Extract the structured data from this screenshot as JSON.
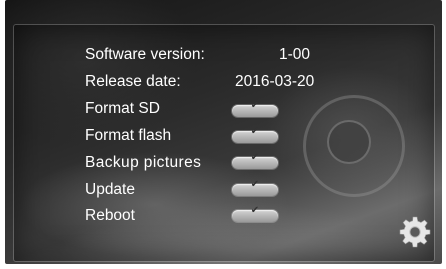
{
  "settings": {
    "software_version": {
      "label": "Software version:",
      "value": "1-00"
    },
    "release_date": {
      "label": "Release date:",
      "value": "2016-03-20"
    },
    "actions": [
      {
        "label": "Format SD",
        "control_glyph": "✔"
      },
      {
        "label": "Format flash",
        "control_glyph": "✔"
      },
      {
        "label": "Backup pictures",
        "control_glyph": "✔"
      },
      {
        "label": "Update",
        "control_glyph": "✔"
      },
      {
        "label": "Reboot",
        "control_glyph": "✔"
      }
    ]
  },
  "icons": {
    "settings_button": "gear-icon"
  }
}
